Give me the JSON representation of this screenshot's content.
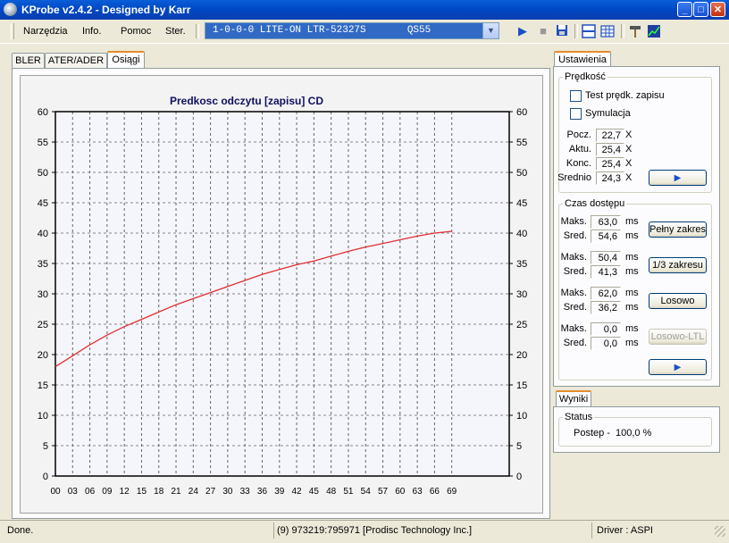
{
  "window": {
    "title": "KProbe v2.4.2 - Designed by Karr"
  },
  "menu": [
    {
      "label": "Narzędzia"
    },
    {
      "label": "Info."
    },
    {
      "label": "Pomoc"
    },
    {
      "label": "Ster."
    }
  ],
  "drive": {
    "selected": "1-0-0-0 LITE-ON LTR-52327S       QS55"
  },
  "tabs": [
    {
      "label": "BLER"
    },
    {
      "label": "ATER/ADER"
    },
    {
      "label": "Osiągi"
    }
  ],
  "chart_data": {
    "type": "line",
    "title": "Predkosc odczytu [zapisu] CD",
    "xlabel": "",
    "ylabel": "",
    "x_ticks": [
      "00",
      "03",
      "06",
      "09",
      "12",
      "15",
      "18",
      "21",
      "24",
      "27",
      "30",
      "33",
      "36",
      "39",
      "42",
      "45",
      "48",
      "51",
      "54",
      "57",
      "60",
      "63",
      "66",
      "69"
    ],
    "y_ticks": [
      0,
      5,
      10,
      15,
      20,
      25,
      30,
      35,
      40,
      45,
      50,
      55,
      60
    ],
    "xlim": [
      0,
      79
    ],
    "ylim": [
      0,
      60
    ],
    "grid": true,
    "series": [
      {
        "name": "",
        "color": "#e03030",
        "x": [
          0,
          3,
          6,
          9,
          12,
          15,
          18,
          21,
          24,
          27,
          30,
          33,
          36,
          39,
          42,
          45,
          48,
          51,
          54,
          57,
          60,
          63,
          66,
          69
        ],
        "y": [
          18.0,
          19.8,
          21.6,
          23.2,
          24.6,
          25.8,
          27.0,
          28.2,
          29.2,
          30.2,
          31.2,
          32.2,
          33.2,
          34.0,
          34.8,
          35.4,
          36.2,
          37.0,
          37.7,
          38.3,
          38.9,
          39.5,
          40.0,
          40.3
        ]
      }
    ]
  },
  "settings": {
    "tab": "Ustawienia",
    "speed_group": "Prędkość",
    "test_write_label": "Test prędk. zapisu",
    "simulation_label": "Symulacja",
    "rows": [
      {
        "label": "Pocz.",
        "value": "22,7",
        "unit": "X"
      },
      {
        "label": "Aktu.",
        "value": "25,4",
        "unit": "X"
      },
      {
        "label": "Konc.",
        "value": "25,4",
        "unit": "X"
      },
      {
        "label": "Srednio",
        "value": "24,3",
        "unit": "X"
      }
    ],
    "access_group": "Czas dostępu",
    "access": [
      {
        "max_label": "Maks.",
        "max": "63,0",
        "avg_label": "Sred.",
        "avg": "54,6",
        "unit": "ms",
        "button": "Pełny zakres"
      },
      {
        "max_label": "Maks.",
        "max": "50,4",
        "avg_label": "Sred.",
        "avg": "41,3",
        "unit": "ms",
        "button": "1/3 zakresu"
      },
      {
        "max_label": "Maks.",
        "max": "62,0",
        "avg_label": "Sred.",
        "avg": "36,2",
        "unit": "ms",
        "button": "Losowo"
      },
      {
        "max_label": "Maks.",
        "max": "0,0",
        "avg_label": "Sred.",
        "avg": "0,0",
        "unit": "ms",
        "button": "Losowo-LTL"
      }
    ]
  },
  "results": {
    "tab": "Wyniki",
    "status_group": "Status",
    "progress_label": "Postep -",
    "progress_value": "100,0 %"
  },
  "statusbar": {
    "left": "Done.",
    "middle": "(9) 973219:795971 [Prodisc Technology Inc.]",
    "right": "Driver : ASPI"
  }
}
